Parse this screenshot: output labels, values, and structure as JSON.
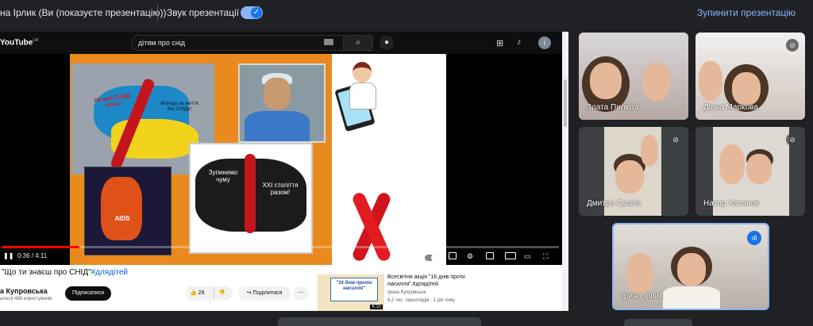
{
  "topbar": {
    "presenter_label": "на Ірлик (Ви (показуєте презентацію))",
    "sound_label": "Звук презентації",
    "stop_label": "Зупинити презентацію"
  },
  "youtube": {
    "logo_text": "YouTube",
    "logo_region": "UA",
    "search_query": "дітям про снід",
    "player": {
      "time": "0:36 / 4:11",
      "progress_fraction": 0.14,
      "slide": {
        "poster1_text": "Не дай СНІДу шанс!",
        "poster1_subtext": "Молодь за життя без СНІДу!",
        "poster3_text": "AIDS",
        "poster4_left": "Зупинемо чуму",
        "poster4_right": "XXI століття разом!"
      }
    },
    "video": {
      "title": "\"Що ти знаєш про СНІД\"",
      "hashtag": "#длядітей",
      "channel": "а Купровська",
      "subscribers": "алося 488 користувачів",
      "subscribe_label": "Підписатися",
      "likes": "28",
      "share_label": "Поділитися",
      "more_label": "···"
    },
    "recommended": {
      "thumb_text": "\"16 днів проти насилля\"",
      "duration": "6:15",
      "title": "Всесвітня акція \"16 днів проти насилля\".#длядітей",
      "channel": "Ірина Купровська",
      "meta": "6,2 тис. переглядів · 1 рік тому"
    }
  },
  "participants": [
    {
      "name": "Злата Пилюта",
      "muted": false
    },
    {
      "name": "Діана Маркова",
      "muted": true
    },
    {
      "name": "Дмитро Сушко",
      "muted": true
    },
    {
      "name": "Назар Хасанов",
      "muted": true
    },
    {
      "name": "Ірина Ірлик",
      "muted": false
    }
  ],
  "colors": {
    "accent": "#8ab4f8",
    "background": "#202124",
    "tile": "#3c4043",
    "slide_orange": "#e98a1e",
    "ribbon_red": "#c3161c"
  }
}
